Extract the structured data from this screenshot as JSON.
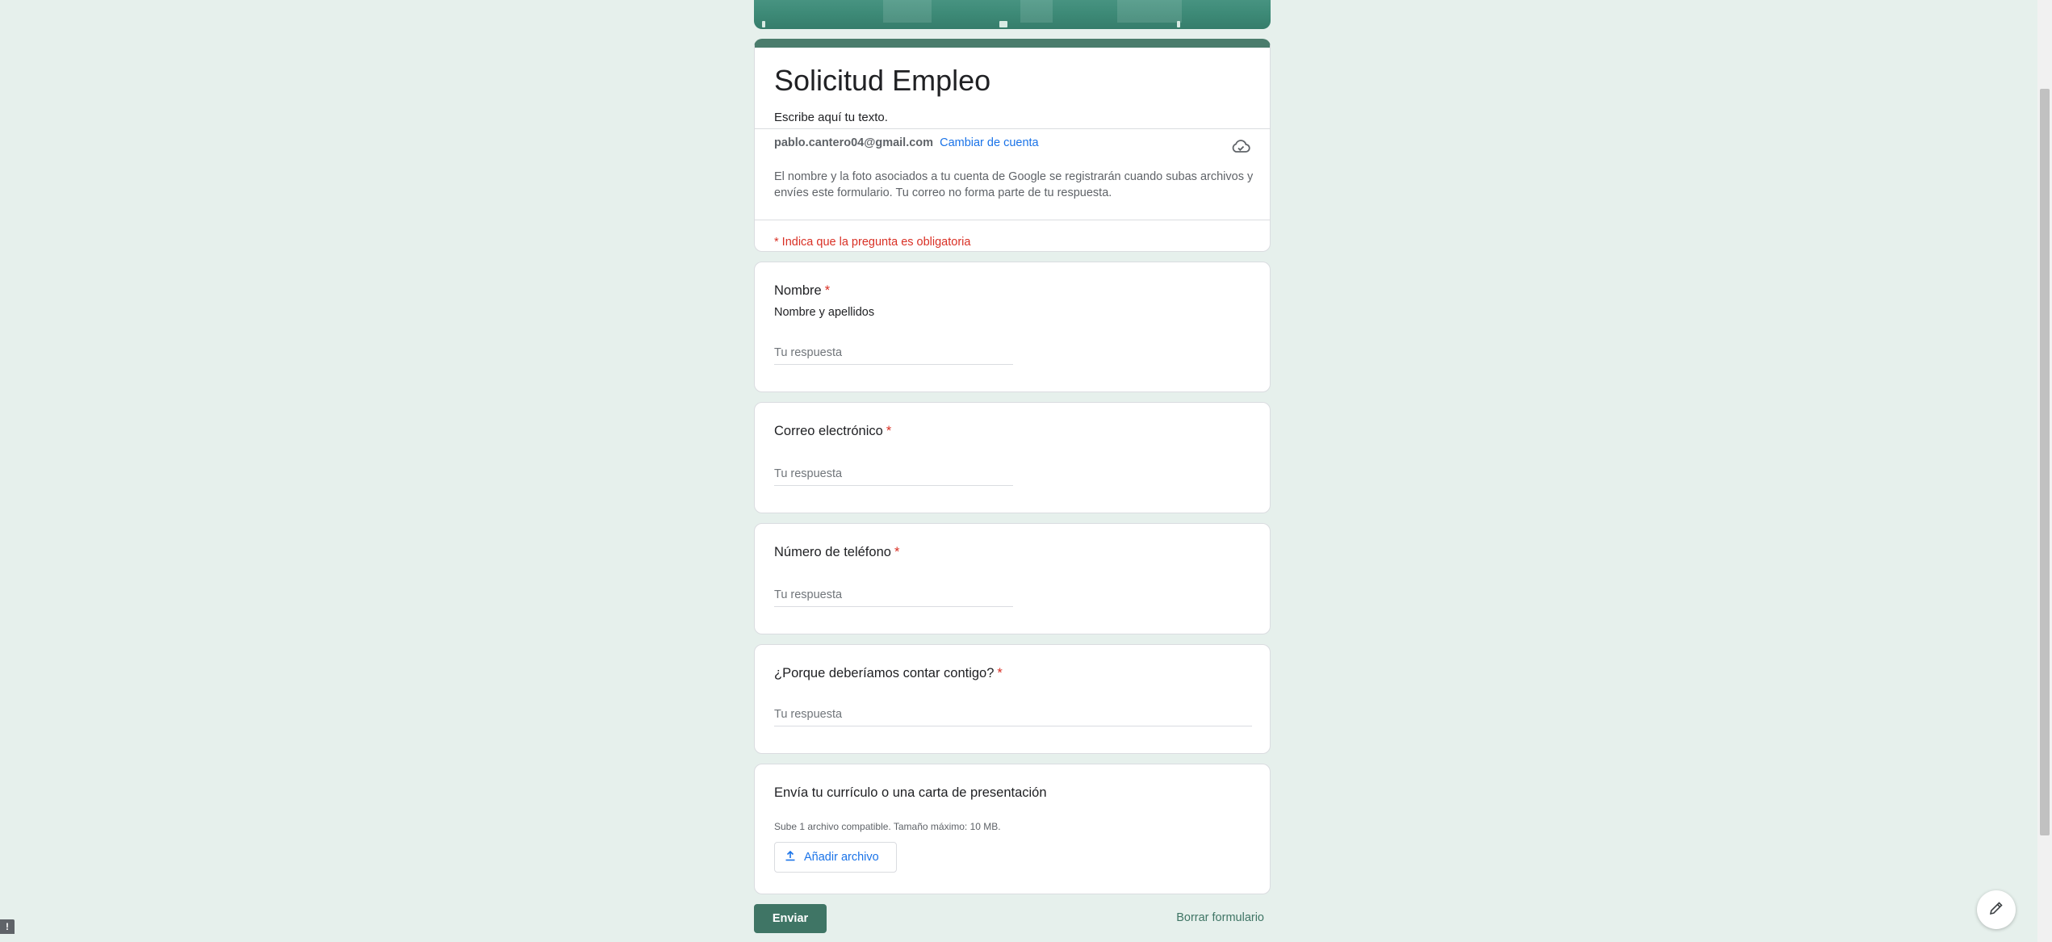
{
  "form": {
    "title": "Solicitud Empleo",
    "description": "Escribe aquí tu texto.",
    "account_email": "pablo.cantero04@gmail.com",
    "switch_account_label": "Cambiar de cuenta",
    "privacy_note": "El nombre y la foto asociados a tu cuenta de Google se registrarán cuando subas archivos y envíes este formulario. Tu correo no forma parte de tu respuesta.",
    "required_note": "* Indica que la pregunta es obligatoria"
  },
  "questions": [
    {
      "title": "Nombre",
      "required_mark": "*",
      "description": "Nombre y apellidos",
      "placeholder": "Tu respuesta"
    },
    {
      "title": "Correo electrónico",
      "required_mark": "*",
      "placeholder": "Tu respuesta"
    },
    {
      "title": "Número de teléfono",
      "required_mark": "*",
      "placeholder": "Tu respuesta"
    },
    {
      "title": "¿Porque deberíamos contar contigo?",
      "required_mark": "*",
      "placeholder": "Tu respuesta"
    }
  ],
  "upload": {
    "title": "Envía tu currículo o una carta de presentación",
    "note": "Sube 1 archivo compatible. Tamaño máximo: 10 MB.",
    "button_label": "Añadir archivo"
  },
  "actions": {
    "submit_label": "Enviar",
    "clear_label": "Borrar formulario"
  },
  "feedback_label": "!",
  "colors": {
    "background": "#e6f0ec",
    "theme": "#3f7565",
    "link": "#1a73e8",
    "required": "#d93025"
  },
  "icons": [
    "cloud-icon",
    "upload-icon",
    "edit-pencil-icon"
  ]
}
